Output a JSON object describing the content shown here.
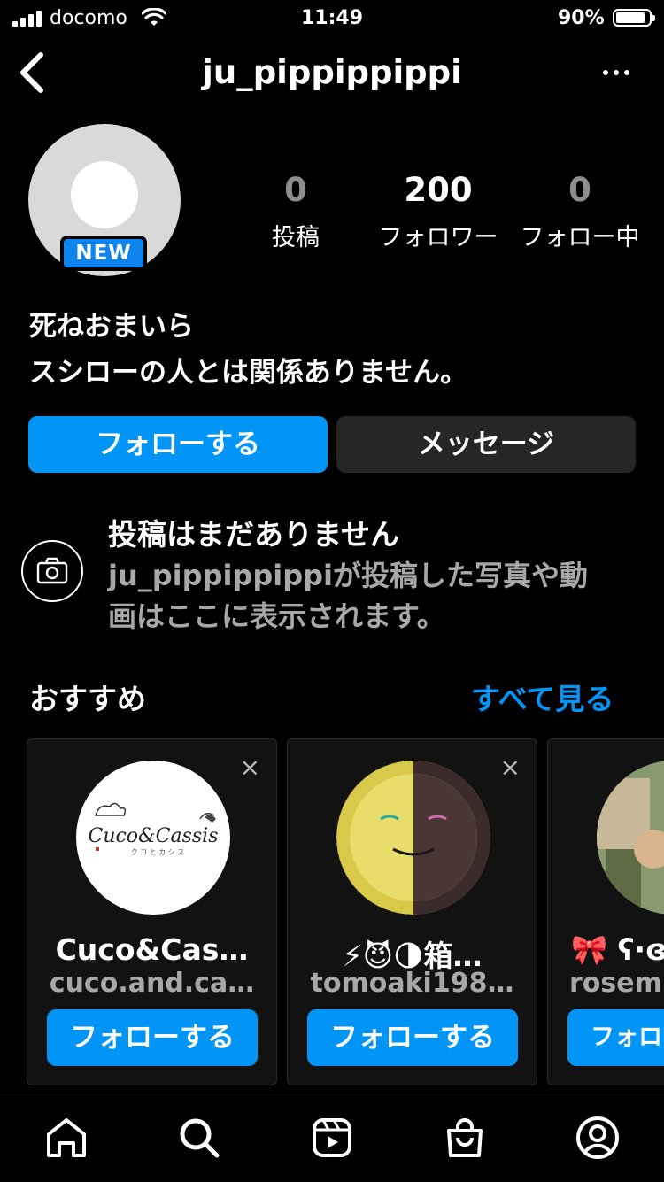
{
  "status_bar": {
    "carrier": "docomo",
    "time": "11:49",
    "battery_pct": "90%",
    "battery_level": 0.9
  },
  "header": {
    "username": "ju_pippippippi",
    "back_icon": "chevron-left-icon",
    "more_icon": "ellipsis-icon"
  },
  "profile": {
    "badge": "NEW",
    "stats": [
      {
        "value": "0",
        "label": "投稿"
      },
      {
        "value": "200",
        "label": "フォロワー"
      },
      {
        "value": "0",
        "label": "フォロー中"
      }
    ],
    "bio_line1": "死ねおまいら",
    "bio_line2": "スシローの人とは関係ありません。"
  },
  "actions": {
    "follow": "フォローする",
    "message": "メッセージ"
  },
  "empty_posts": {
    "title": "投稿はまだありません",
    "desc_line1": "ju_pippippippiが投稿した写真や動",
    "desc_line2": "画はここに表示されます。"
  },
  "suggestions": {
    "title": "おすすめ",
    "see_all": "すべて見る",
    "cards": [
      {
        "name": "Cuco&Cas…",
        "username": "cuco.and.ca…",
        "button": "フォローする",
        "close": "×",
        "logo_text": "Cuco&Cassis",
        "logo_sub": "ク コ と カ シ ス"
      },
      {
        "name": "⚡😈🌗箱…",
        "username": "tomoaki198…",
        "button": "フォローする",
        "close": "×"
      },
      {
        "name": "🎀 ʕ·ɞ",
        "username": "rosem",
        "button": "フォロー"
      }
    ]
  },
  "tabbar": {
    "tabs": [
      "home-icon",
      "search-icon",
      "reels-icon",
      "shop-icon",
      "profile-icon"
    ]
  },
  "colors": {
    "accent": "#0095f6",
    "background": "#000000",
    "secondary_text": "#a8a8a8"
  }
}
